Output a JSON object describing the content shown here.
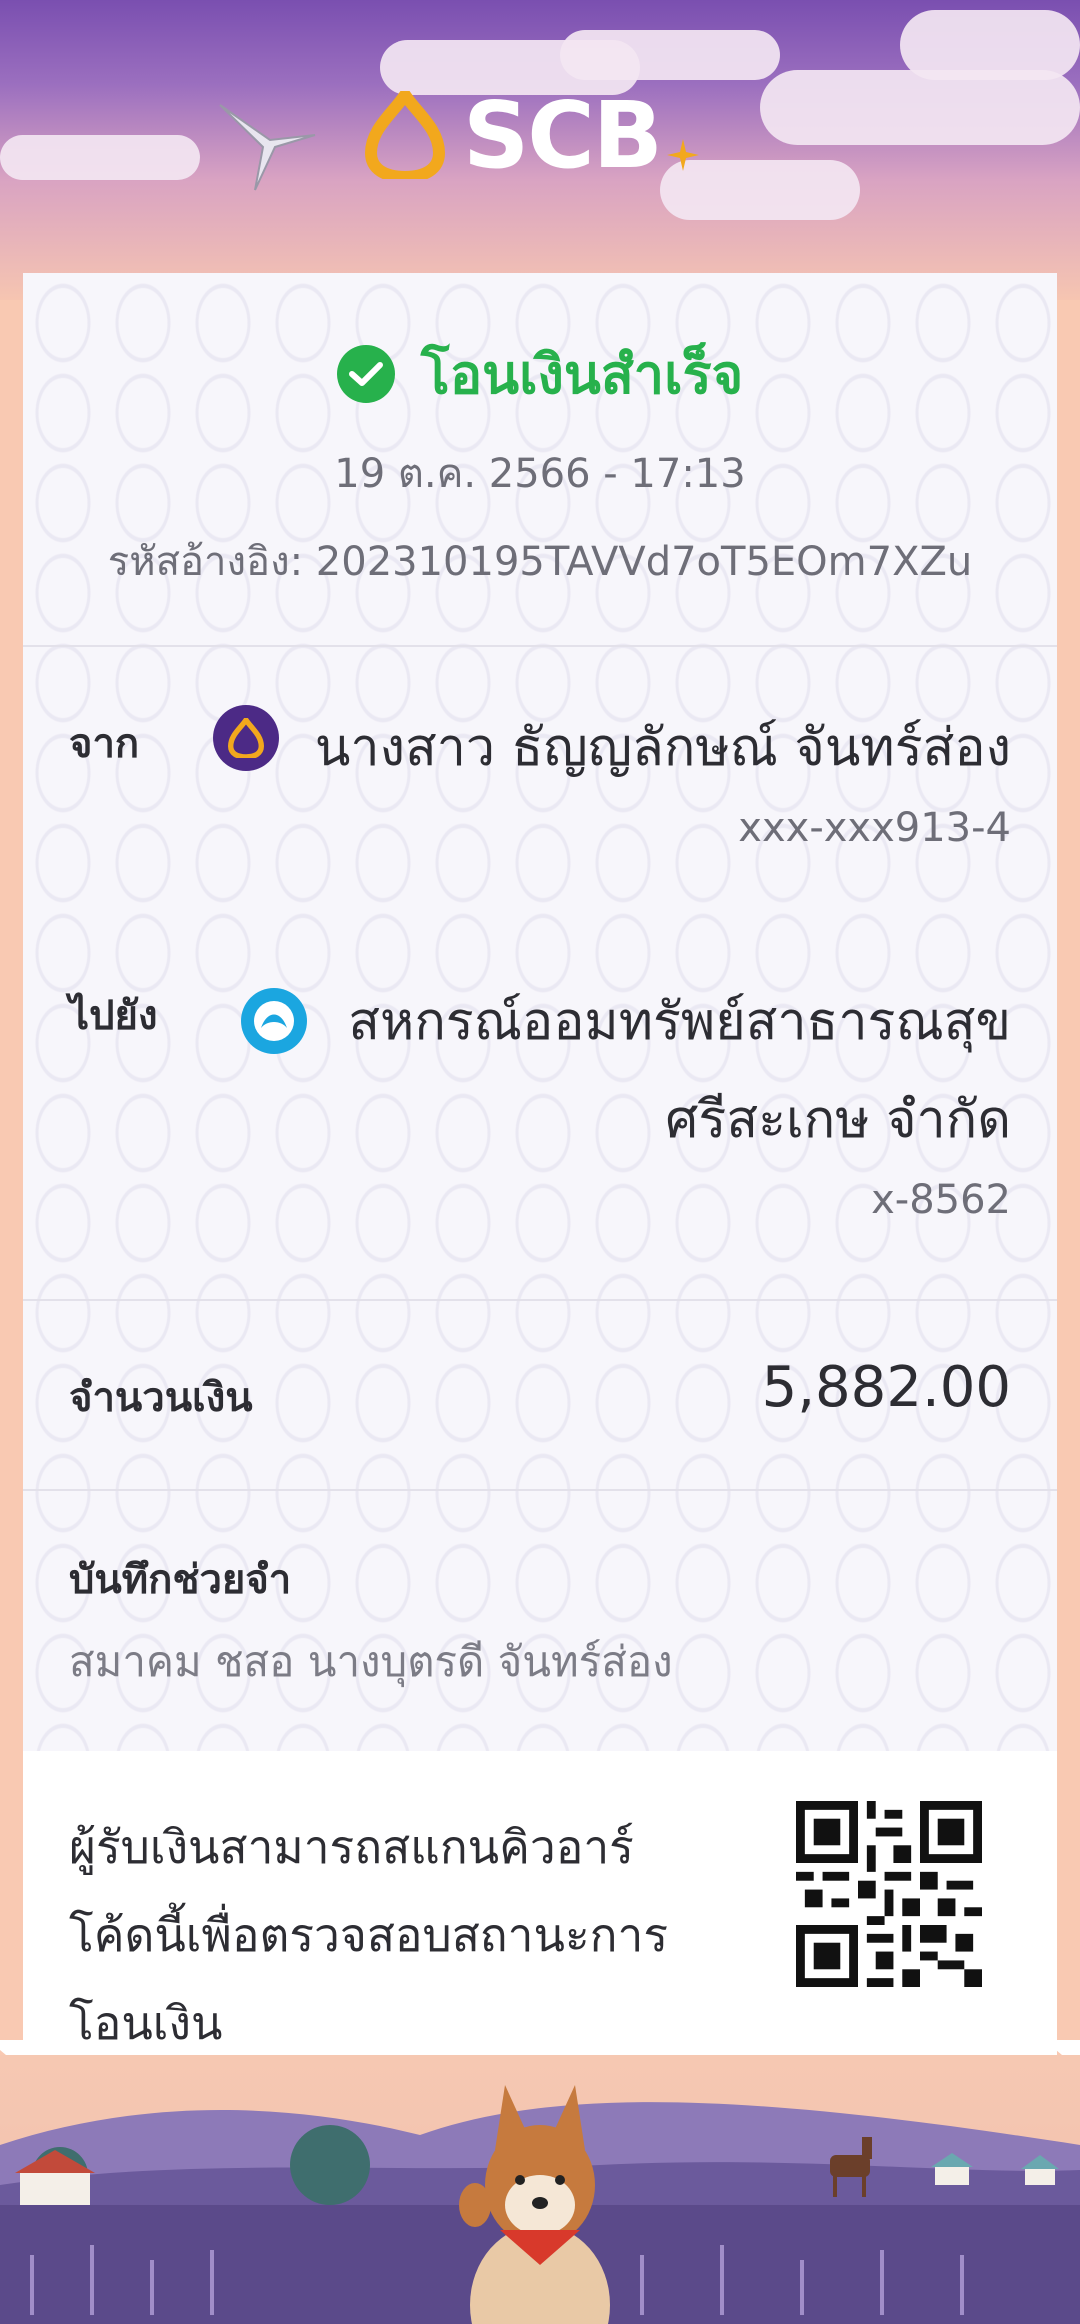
{
  "header": {
    "brand": "SCB",
    "colors": {
      "sky_top": "#7a4fb0",
      "accent_gold": "#f2a81d"
    }
  },
  "receipt": {
    "status": {
      "title": "โอนเงินสำเร็จ",
      "icon": "check-circle-icon",
      "color": "#27b14c"
    },
    "datetime": "19 ต.ค. 2566 - 17:13",
    "reference": "รหัสอ้างอิง: 202310195TAVVd7oT5EOm7XZu",
    "from": {
      "label": "จาก",
      "name": "นางสาว ธัญญลักษณ์ จันทร์ส่อง",
      "account": "xxx-xxx913-4",
      "bank_icon": "scb-bank-icon"
    },
    "to": {
      "label": "ไปยัง",
      "name_line1": "สหกรณ์ออมทรัพย์สาธารณสุข",
      "name_line2": "ศรีสะเกษ จำกัด",
      "account": "x-8562",
      "bank_icon": "krungthai-bank-icon"
    },
    "amount": {
      "label": "จำนวนเงิน",
      "value": "5,882.00"
    },
    "memo": {
      "label": "บันทึกช่วยจำ",
      "value": "สมาคม ชสอ นางบุตรดี จันทร์ส่อง"
    },
    "qr": {
      "text_line1": "ผู้รับเงินสามารถสแกนคิวอาร์",
      "text_line2": "โค้ดนี้เพื่อตรวจสอบสถานะการ",
      "text_line3": "โอนเงิน"
    }
  }
}
